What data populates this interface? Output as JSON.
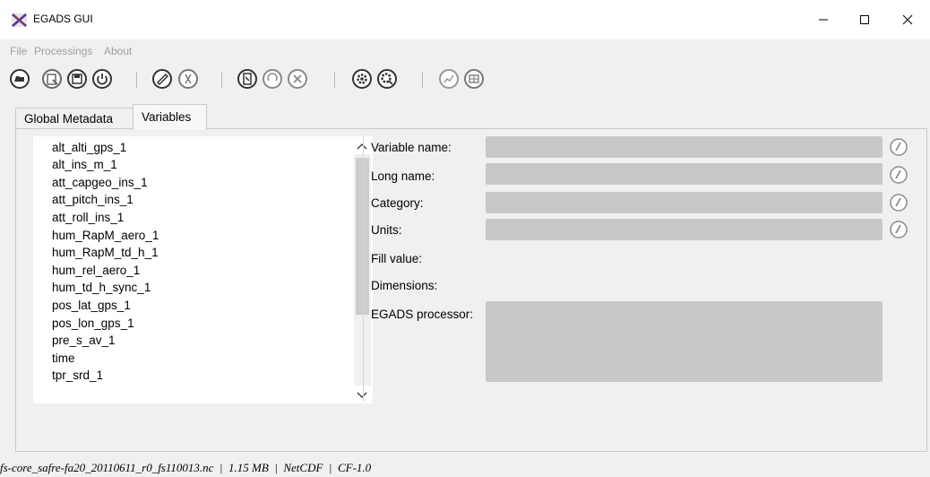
{
  "window": {
    "title": "EGADS GUI"
  },
  "menu": {
    "items": [
      "File",
      "Processings",
      "About"
    ]
  },
  "tabs": {
    "global_metadata": "Global Metadata",
    "variables": "Variables"
  },
  "variables": {
    "items": [
      "alt_alti_gps_1",
      "alt_ins_m_1",
      "att_capgeo_ins_1",
      "att_pitch_ins_1",
      "att_roll_ins_1",
      "hum_RapM_aero_1",
      "hum_RapM_td_h_1",
      "hum_rel_aero_1",
      "hum_td_h_sync_1",
      "pos_lat_gps_1",
      "pos_lon_gps_1",
      "pre_s_av_1",
      "time",
      "tpr_srd_1"
    ]
  },
  "fields": {
    "variable_name": "Variable name:",
    "long_name": "Long name:",
    "category": "Category:",
    "units": "Units:",
    "fill_value": "Fill value:",
    "dimensions": "Dimensions:",
    "egads_processor": "EGADS processor:"
  },
  "status": {
    "text": "fs-core_safre-fa20_20110611_r0_fs110013.nc  |  1.15 MB  |  NetCDF  |  CF-1.0"
  },
  "toolbar_icons": [
    "open-file-icon",
    "close-file-icon",
    "save-file-icon",
    "exit-icon",
    "add-item-icon",
    "delete-item-icon",
    "display-icon",
    "undo-icon",
    "cancel-icon",
    "process-icon",
    "algorithm-icon",
    "plot-icon",
    "create-file-icon"
  ]
}
